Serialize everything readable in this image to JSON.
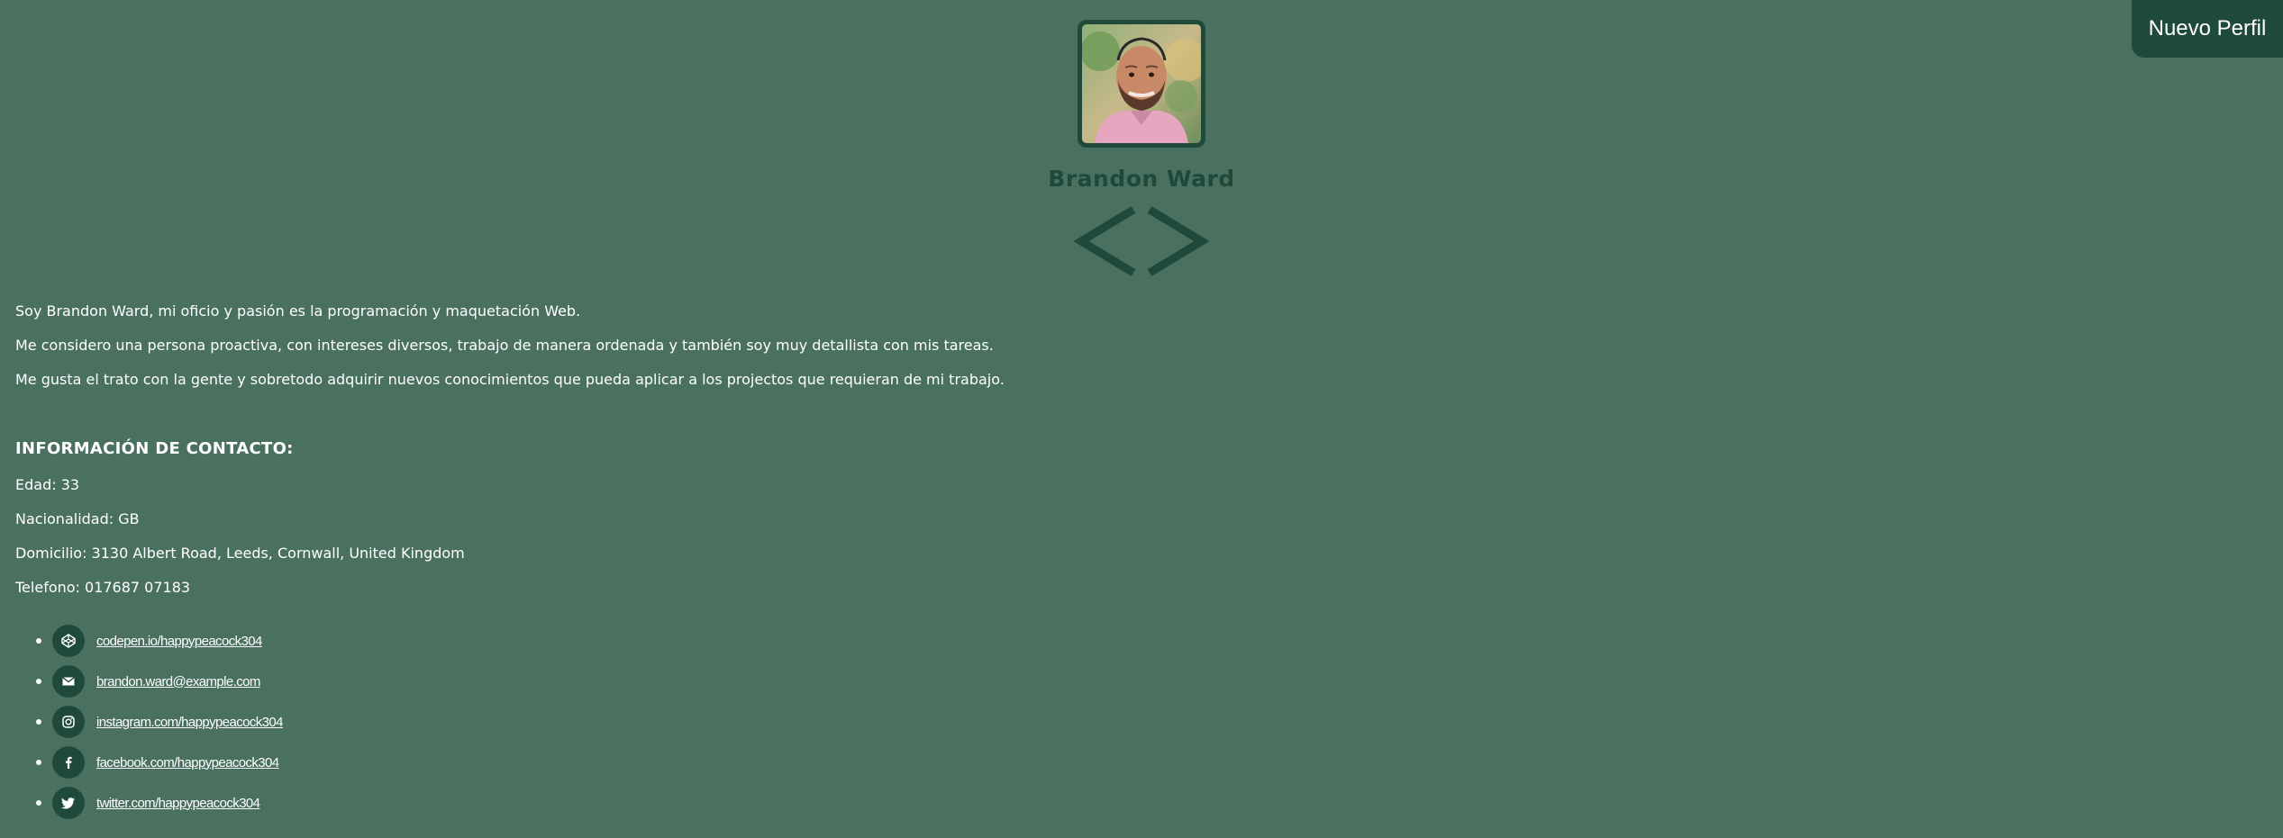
{
  "header": {
    "new_profile_label": "Nuevo Perfil",
    "name": "Brandon Ward"
  },
  "bio": {
    "paragraphs": [
      "Soy Brandon Ward, mi oficio y pasión es la programación y maquetación Web.",
      "Me considero una persona proactiva, con intereses diversos, trabajo de manera ordenada y también soy muy detallista con mis tareas.",
      "Me gusta el trato con la gente y sobretodo adquirir nuevos conocimientos que pueda aplicar a los projectos que requieran de mi trabajo."
    ]
  },
  "contact": {
    "heading": "INFORMACIÓN DE CONTACTO:",
    "age": "Edad: 33",
    "nationality": "Nacionalidad: GB",
    "address": "Domicilio: 3130 Albert Road, Leeds, Cornwall, United Kingdom",
    "phone": "Telefono: 017687 07183"
  },
  "links": [
    {
      "icon": "codepen-icon",
      "label": "codepen.io/happypeacock304"
    },
    {
      "icon": "envelope-icon",
      "label": "brandon.ward@example.com"
    },
    {
      "icon": "instagram-icon",
      "label": "instagram.com/happypeacock304"
    },
    {
      "icon": "facebook-icon",
      "label": "facebook.com/happypeacock304"
    },
    {
      "icon": "twitter-icon",
      "label": "twitter.com/happypeacock304"
    }
  ],
  "colors": {
    "background": "#4a7060",
    "accent_dark": "#1f4a3b",
    "text": "#ffffff"
  }
}
